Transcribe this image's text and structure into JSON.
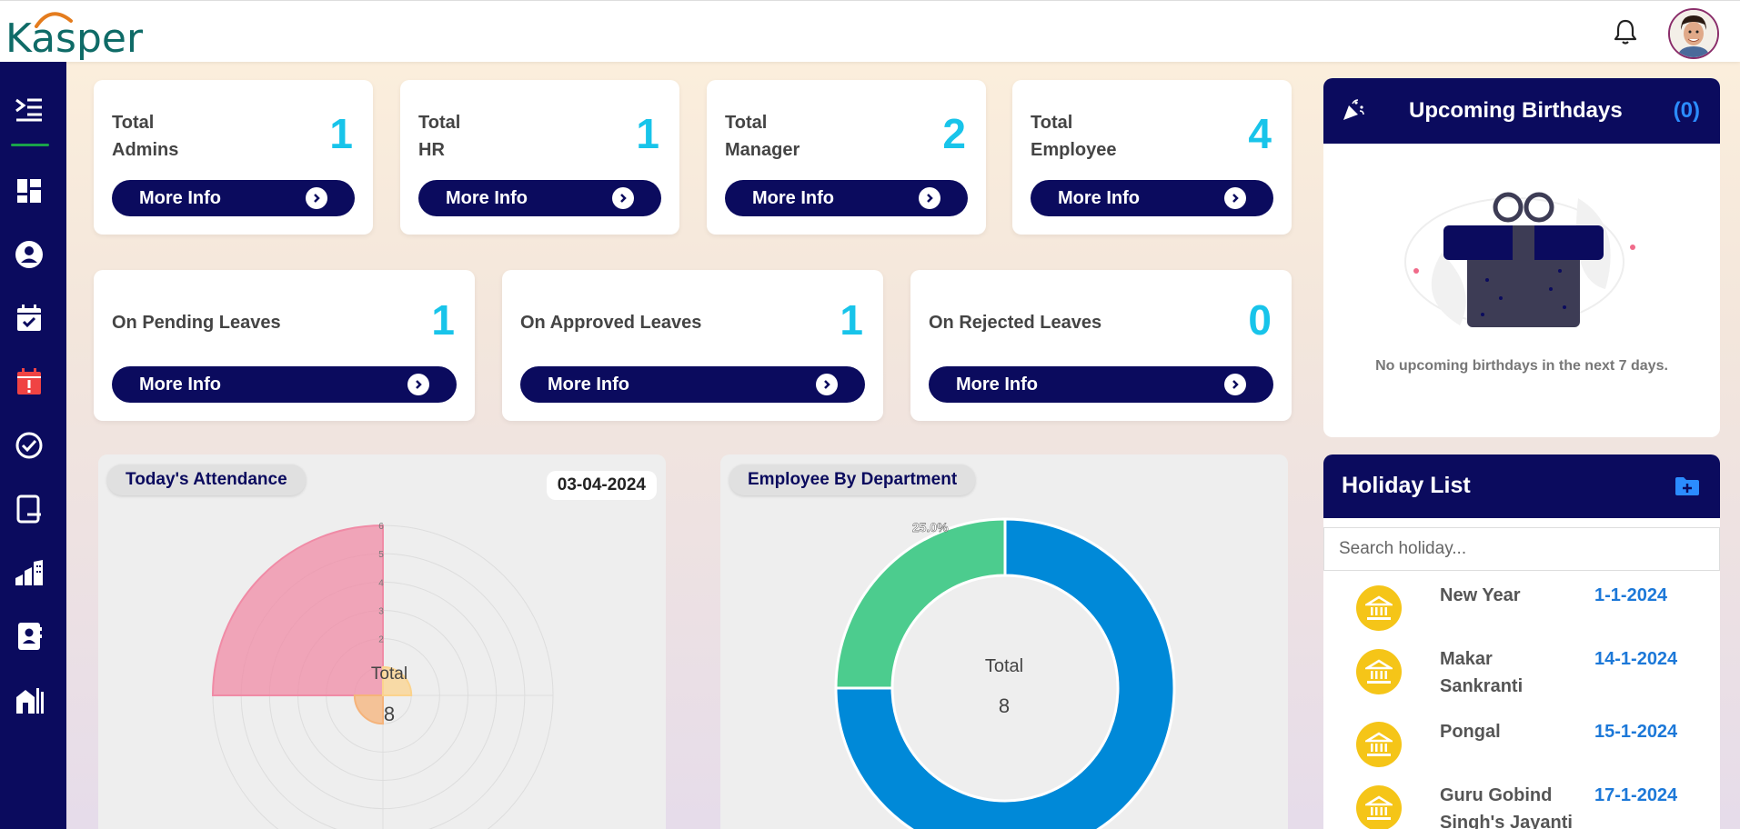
{
  "app": {
    "logo_text": "Kasper"
  },
  "stats_top": [
    {
      "title_line1": "Total",
      "title_line2": "Admins",
      "value": "1",
      "button": "More Info"
    },
    {
      "title_line1": "Total",
      "title_line2": "HR",
      "value": "1",
      "button": "More Info"
    },
    {
      "title_line1": "Total",
      "title_line2": "Manager",
      "value": "2",
      "button": "More Info"
    },
    {
      "title_line1": "Total",
      "title_line2": "Employee",
      "value": "4",
      "button": "More Info"
    }
  ],
  "stats_leaves": [
    {
      "title": "On Pending Leaves",
      "value": "1",
      "button": "More Info"
    },
    {
      "title": "On Approved Leaves",
      "value": "1",
      "button": "More Info"
    },
    {
      "title": "On Rejected Leaves",
      "value": "0",
      "button": "More Info"
    }
  ],
  "attendance": {
    "title": "Today's Attendance",
    "date": "03-04-2024",
    "center_label": "Total",
    "center_value": "8",
    "ticks": [
      "6",
      "5",
      "4",
      "3",
      "2"
    ]
  },
  "department": {
    "title": "Employee By Department",
    "center_label": "Total",
    "center_value": "8"
  },
  "chart_data": [
    {
      "type": "polar-area",
      "title": "Today's Attendance",
      "radial_ticks": [
        2,
        3,
        4,
        5,
        6
      ],
      "rlim": [
        0,
        6
      ],
      "values": [
        6,
        1,
        1
      ],
      "colors": [
        "#f08ba6",
        "#f5b37a",
        "#fbd38d"
      ]
    },
    {
      "type": "pie",
      "title": "Employee By Department",
      "values": [
        75.0,
        25.0
      ],
      "labels": [
        "75.0%",
        "25.0%"
      ],
      "colors": [
        "#0089d8",
        "#4ccc8e"
      ]
    }
  ],
  "birthdays": {
    "title": "Upcoming Birthdays",
    "count": "(0)",
    "message": "No upcoming birthdays in the next 7 days."
  },
  "holidays": {
    "title": "Holiday List",
    "search_placeholder": "Search holiday...",
    "items": [
      {
        "name": "New Year",
        "date": "1-1-2024"
      },
      {
        "name": "Makar Sankranti",
        "date": "14-1-2024"
      },
      {
        "name": "Pongal",
        "date": "15-1-2024"
      },
      {
        "name": "Guru Gobind Singh's Jayanti",
        "date": "17-1-2024"
      }
    ]
  },
  "sidebar": {
    "icons": [
      "menu-collapse-icon",
      "dashboard-icon",
      "user-icon",
      "calendar-check-icon",
      "calendar-alert-icon",
      "check-circle-icon",
      "tablet-icon",
      "building-chart-icon",
      "contact-book-icon",
      "company-icon"
    ]
  }
}
